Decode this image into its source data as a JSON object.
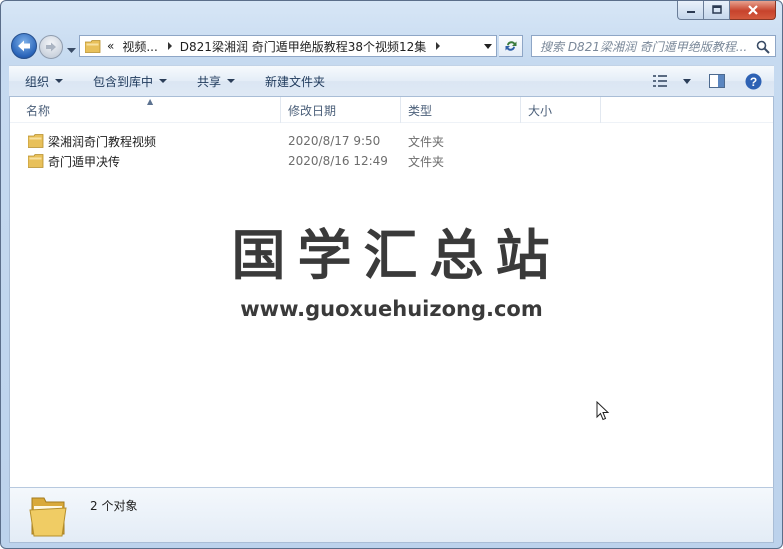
{
  "window": {
    "address": {
      "overflow_chevron": "«",
      "segments": [
        "视频...",
        "D821梁湘润 奇门遁甲绝版教程38个视频12集"
      ]
    },
    "search_placeholder": "搜索 D821梁湘润 奇门遁甲绝版教程..."
  },
  "toolbar": {
    "organize": "组织",
    "include_in_library": "包含到库中",
    "share": "共享",
    "new_folder": "新建文件夹",
    "icons": [
      "views-icon",
      "preview-pane-icon",
      "help-icon"
    ]
  },
  "columns": {
    "name": "名称",
    "date": "修改日期",
    "type": "类型",
    "size": "大小"
  },
  "files": [
    {
      "name": "梁湘润奇门教程视频",
      "date": "2020/8/17 9:50",
      "type": "文件夹"
    },
    {
      "name": "奇门遁甲决传",
      "date": "2020/8/16 12:49",
      "type": "文件夹"
    }
  ],
  "watermark": {
    "title": "国学汇总站",
    "url": "www.guoxuehuizong.com"
  },
  "details": {
    "count_text": "2 个对象"
  },
  "colors": {
    "folder": "#e8c05a",
    "close_red": "#c7432c",
    "accent_blue": "#2964b9"
  }
}
